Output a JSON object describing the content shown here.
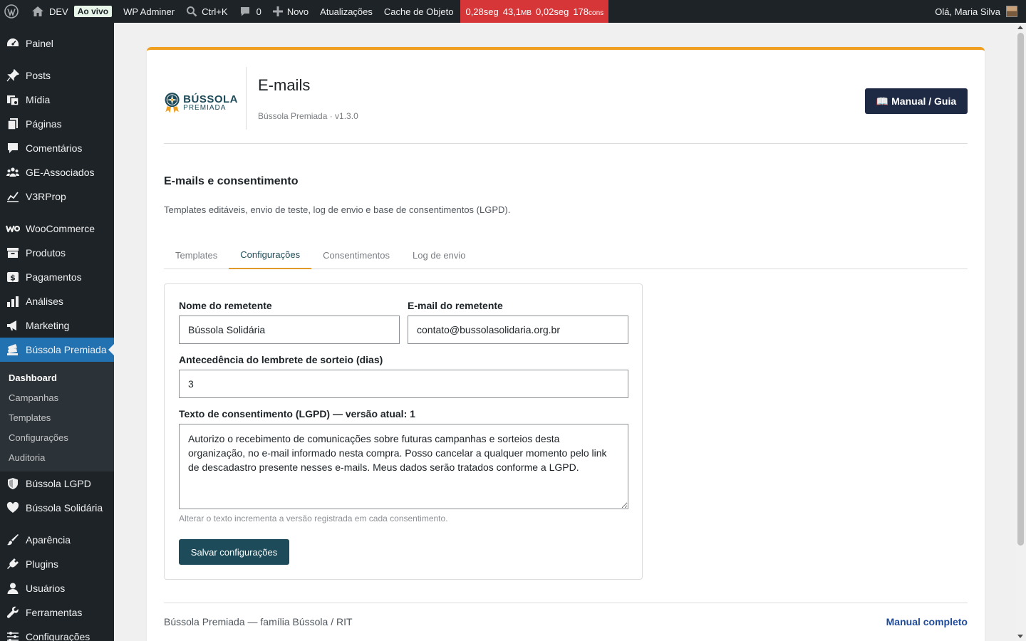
{
  "adminbar": {
    "site_name": "DEV",
    "live_badge": "Ao vivo",
    "wp_adminer": "WP Adminer",
    "search_shortcut": "Ctrl+K",
    "comments_count": "0",
    "new_label": "Novo",
    "updates_label": "Atualizações",
    "cache_label": "Cache de Objeto",
    "perf": {
      "time1": "0,28seg",
      "mem": "43,1",
      "mem_unit": "MB",
      "time2": "0,02seg",
      "queries": "178",
      "queries_unit": "cons"
    },
    "greeting": "Olá, Maria Silva"
  },
  "sidebar": {
    "items": [
      {
        "label": "Painel",
        "icon": "dashboard-icon"
      },
      {
        "label": "Posts",
        "icon": "pin-icon"
      },
      {
        "label": "Mídia",
        "icon": "media-icon"
      },
      {
        "label": "Páginas",
        "icon": "pages-icon"
      },
      {
        "label": "Comentários",
        "icon": "comment-icon"
      },
      {
        "label": "GE-Associados",
        "icon": "groups-icon"
      },
      {
        "label": "V3RProp",
        "icon": "chart-line-icon"
      },
      {
        "label": "WooCommerce",
        "icon": "woo-icon"
      },
      {
        "label": "Produtos",
        "icon": "archive-icon"
      },
      {
        "label": "Pagamentos",
        "icon": "money-icon"
      },
      {
        "label": "Análises",
        "icon": "bar-chart-icon"
      },
      {
        "label": "Marketing",
        "icon": "megaphone-icon"
      },
      {
        "label": "Bússola Premiada",
        "icon": "tickets-icon"
      },
      {
        "label": "Bússola LGPD",
        "icon": "shield-icon"
      },
      {
        "label": "Bússola Solidária",
        "icon": "heart-icon"
      },
      {
        "label": "Aparência",
        "icon": "brush-icon"
      },
      {
        "label": "Plugins",
        "icon": "plugin-icon"
      },
      {
        "label": "Usuários",
        "icon": "user-icon"
      },
      {
        "label": "Ferramentas",
        "icon": "wrench-icon"
      },
      {
        "label": "Configurações",
        "icon": "settings-icon"
      }
    ],
    "submenu": [
      "Dashboard",
      "Campanhas",
      "Templates",
      "Configurações",
      "Auditoria"
    ]
  },
  "header": {
    "logo_line1": "BÚSSOLA",
    "logo_line2": "PREMIADA",
    "title": "E-mails",
    "meta": "Bússola Premiada · v1.3.0",
    "manual_button": "📖 Manual / Guia"
  },
  "section": {
    "title": "E-mails e consentimento",
    "description": "Templates editáveis, envio de teste, log de envio e base de consentimentos (LGPD)."
  },
  "tabs": [
    "Templates",
    "Configurações",
    "Consentimentos",
    "Log de envio"
  ],
  "form": {
    "sender_name_label": "Nome do remetente",
    "sender_name_value": "Bússola Solidária",
    "sender_email_label": "E-mail do remetente",
    "sender_email_value": "contato@bussolasolidaria.org.br",
    "reminder_label": "Antecedência do lembrete de sorteio (dias)",
    "reminder_value": "3",
    "consent_label": "Texto de consentimento (LGPD) — versão atual: 1",
    "consent_value": "Autorizo o recebimento de comunicações sobre futuras campanhas e sorteios desta organização, no e-mail informado nesta compra. Posso cancelar a qualquer momento pelo link de descadastro presente nesses e-mails. Meus dados serão tratados conforme a LGPD.",
    "consent_hint": "Alterar o texto incrementa a versão registrada em cada consentimento.",
    "save_button": "Salvar configurações"
  },
  "footer": {
    "left": "Bússola Premiada — família Bússola / RIT",
    "right": "Manual completo"
  }
}
